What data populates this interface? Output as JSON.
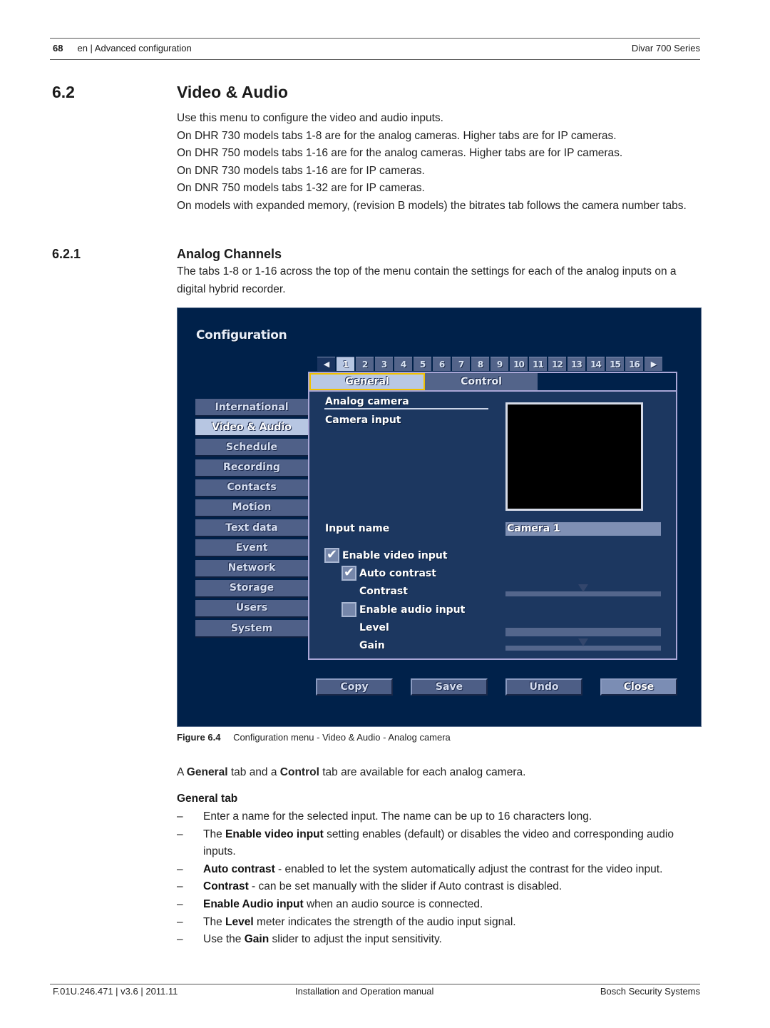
{
  "header": {
    "page_number": "68",
    "section": "en | Advanced configuration",
    "product": "Divar 700 Series"
  },
  "section": {
    "number": "6.2",
    "title": "Video & Audio",
    "paragraphs": [
      "Use this menu to configure the video and audio inputs.",
      "On DHR 730 models tabs 1-8 are for the analog cameras. Higher tabs are for IP cameras.",
      "On DHR 750 models tabs 1-16 are for the analog cameras. Higher tabs are for IP cameras.",
      "On DNR 730 models tabs 1-16 are for IP cameras.",
      "On DNR 750 models tabs 1-32 are for IP cameras.",
      "On models with expanded memory, (revision B models) the bitrates tab follows the camera number tabs."
    ]
  },
  "subsection": {
    "number": "6.2.1",
    "title": "Analog Channels",
    "paragraph": "The tabs 1-8 or 1-16 across the top of the menu contain the settings for each of the analog inputs on a digital hybrid recorder."
  },
  "ui": {
    "title": "Configuration",
    "prev_arrow": "◀",
    "next_arrow": "▶",
    "camera_tabs": [
      "1",
      "2",
      "3",
      "4",
      "5",
      "6",
      "7",
      "8",
      "9",
      "10",
      "11",
      "12",
      "13",
      "14",
      "15",
      "16"
    ],
    "active_camera_tab": "1",
    "subtabs": [
      "General",
      "Control"
    ],
    "active_subtab": "General",
    "sidebar": [
      "International",
      "Video & Audio",
      "Schedule",
      "Recording",
      "Contacts",
      "Motion",
      "Text data",
      "Event",
      "Network",
      "Storage",
      "Users",
      "System"
    ],
    "active_sidebar": "Video & Audio",
    "form": {
      "section_heading": "Analog camera",
      "camera_input_label": "Camera input",
      "input_name_label": "Input name",
      "input_name_value": "Camera 1",
      "enable_video_label": "Enable video input",
      "enable_video_checked": true,
      "auto_contrast_label": "Auto contrast",
      "auto_contrast_checked": true,
      "contrast_label": "Contrast",
      "contrast_value_fraction": 0.5,
      "enable_audio_label": "Enable audio input",
      "enable_audio_checked": false,
      "level_label": "Level",
      "gain_label": "Gain",
      "gain_value_fraction": 0.5,
      "check_glyph": "✔"
    },
    "buttons": [
      "Copy",
      "Save",
      "Undo",
      "Close"
    ]
  },
  "figure": {
    "label": "Figure",
    "number": "6.4",
    "caption": "Configuration menu - Video & Audio - Analog camera"
  },
  "intro_sentence": {
    "parts": [
      "A ",
      "General",
      " tab and a ",
      "Control",
      " tab are available for each analog camera."
    ]
  },
  "general_tab": {
    "heading": "General tab",
    "dash": "–",
    "items": [
      {
        "bold_prefix": "",
        "pre": "",
        "bold": "",
        "text": "Enter a name for the selected input. The name can be up to 16 characters long."
      },
      {
        "pre": "The ",
        "bold": "Enable video input",
        "text": " setting enables (default) or disables the video and corresponding audio inputs."
      },
      {
        "pre": "",
        "bold": "Auto contrast",
        "text": " - enabled to let the system automatically adjust the contrast for the video input."
      },
      {
        "pre": "",
        "bold": "Contrast",
        "text": " - can be set manually with the slider if Auto contrast is disabled."
      },
      {
        "pre": "",
        "bold": "Enable Audio input",
        "text": " when an audio source is connected."
      },
      {
        "pre": "The ",
        "bold": "Level",
        "text": " meter indicates the strength of the audio input signal."
      },
      {
        "pre": "Use the ",
        "bold": "Gain",
        "text": " slider to adjust the input sensitivity."
      }
    ]
  },
  "footer": {
    "doc_id": "F.01U.246.471 | v3.6 | 2011.11",
    "doc_type": "Installation and Operation manual",
    "company": "Bosch Security Systems"
  }
}
